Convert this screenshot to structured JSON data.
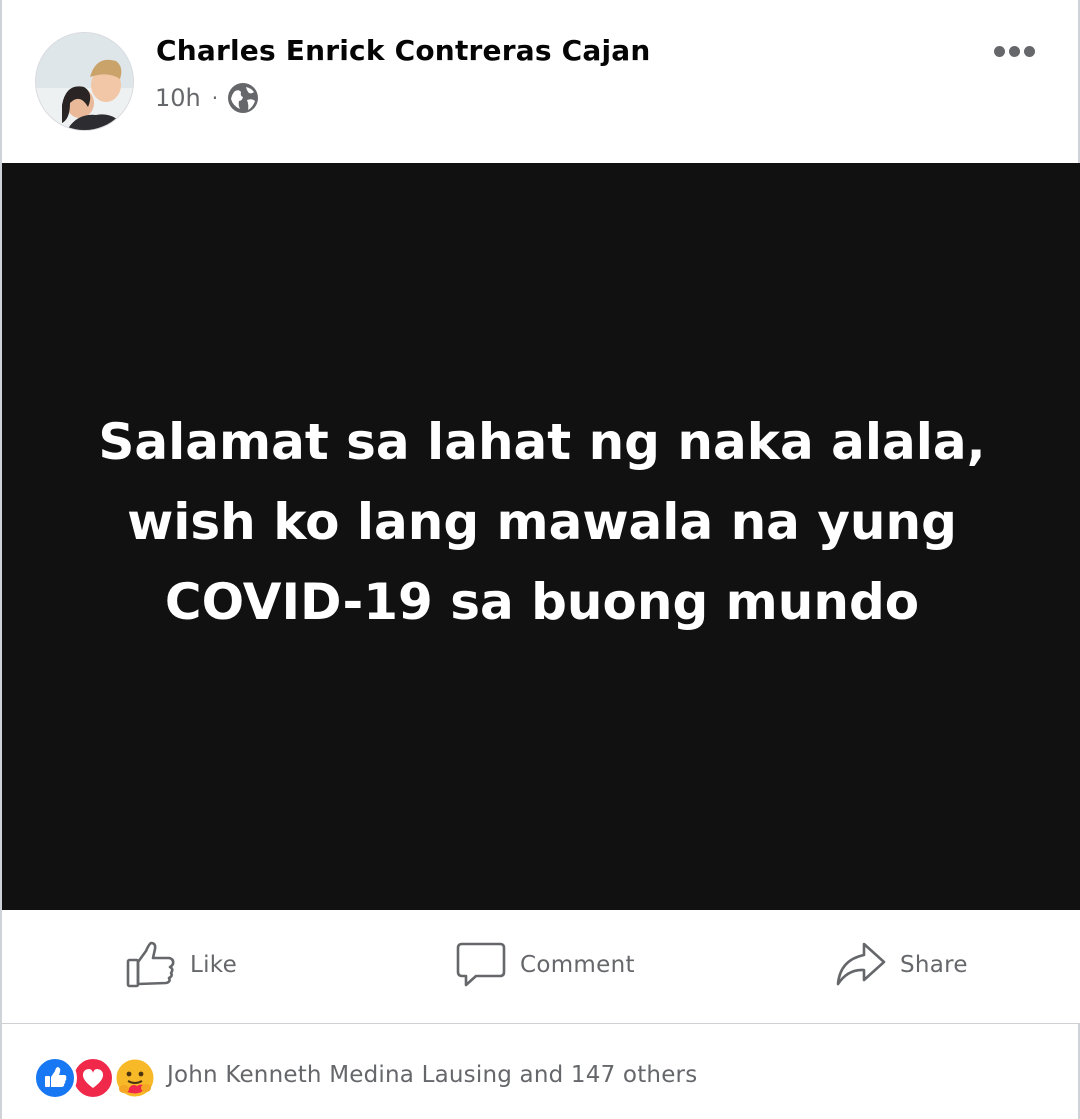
{
  "post": {
    "author": "Charles Enrick Contreras Cajan",
    "time": "10h",
    "separator": "·",
    "privacy_icon": "globe-icon",
    "more_icon": "more-options-icon",
    "card": {
      "background": "#111112",
      "text_color": "#ffffff",
      "lines": [
        "Salamat sa lahat ng naka alala,",
        "wish ko lang mawala na yung",
        "COVID-19 sa buong mundo"
      ]
    }
  },
  "actions": {
    "like_label": "Like",
    "comment_label": "Comment",
    "share_label": "Share"
  },
  "reactions": {
    "icons": [
      "like-reaction-icon",
      "love-reaction-icon",
      "care-reaction-icon"
    ],
    "summary": "John Kenneth Medina Lausing and 147 others"
  },
  "colors": {
    "like_blue": "#1877f2",
    "love_red": "#f0284a",
    "care_yellow": "#f7b928",
    "secondary_text": "#65676b"
  }
}
